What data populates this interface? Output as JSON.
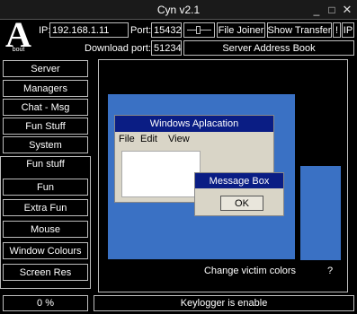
{
  "window": {
    "title": "Cyn v2.1",
    "minimize": "_",
    "maximize": "□",
    "close": "✕"
  },
  "header": {
    "logo_letter": "A",
    "logo_caption": "bout",
    "ip_label": "IP:",
    "ip_value": "192.168.1.11",
    "port_label": "Port:",
    "port_value": "15432",
    "download_port_label": "Download port:",
    "download_port_value": "51234",
    "file_joiner_label": "File Joiner",
    "show_transfer_label": "Show Transfer",
    "exclaim_label": "!",
    "ip_button_label": "IP",
    "server_address_book_label": "Server Address Book"
  },
  "sidebar": {
    "items": [
      {
        "label": "Server"
      },
      {
        "label": "Managers"
      },
      {
        "label": "Chat - Msg"
      },
      {
        "label": "Fun Stuff"
      },
      {
        "label": "System"
      }
    ],
    "fun_stuff_title": "Fun stuff",
    "fun_items": [
      {
        "label": "Fun"
      },
      {
        "label": "Extra Fun"
      },
      {
        "label": "Mouse"
      },
      {
        "label": "Window Colours"
      },
      {
        "label": "Screen Res"
      }
    ]
  },
  "preview": {
    "app_title": "Windows Aplacation",
    "menu": [
      "File",
      "Edit",
      "View"
    ],
    "msgbox_title": "Message Box",
    "msgbox_ok": "OK",
    "change_label": "Change victim colors",
    "help_label": "?"
  },
  "status": {
    "percent": "0 %",
    "message": "Keylogger is enable"
  },
  "colors": {
    "screen": "#3a71c4",
    "titlebar_blue": "#0a1d84",
    "window_gray": "#d9d5c7",
    "border": "#bdbdbd"
  }
}
